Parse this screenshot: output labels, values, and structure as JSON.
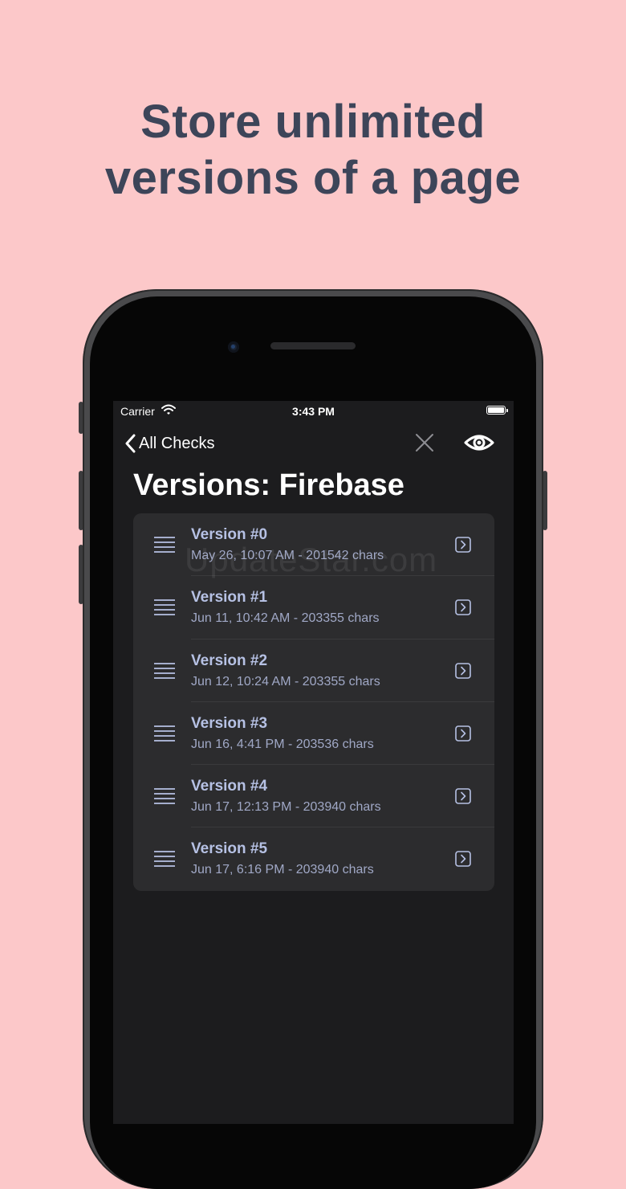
{
  "headline": {
    "line1": "Store unlimited",
    "line2": "versions of a page"
  },
  "status_bar": {
    "carrier": "Carrier",
    "time": "3:43 PM"
  },
  "nav": {
    "back_label": "All Checks",
    "close_icon": "close-icon",
    "eye_icon": "eye-icon"
  },
  "page_title": "Versions: Firebase",
  "versions": [
    {
      "title": "Version #0",
      "subtitle": "May 26, 10:07 AM - 201542 chars"
    },
    {
      "title": "Version #1",
      "subtitle": "Jun 11, 10:42 AM - 203355 chars"
    },
    {
      "title": "Version #2",
      "subtitle": "Jun 12, 10:24 AM - 203355 chars"
    },
    {
      "title": "Version #3",
      "subtitle": "Jun 16, 4:41 PM - 203536 chars"
    },
    {
      "title": "Version #4",
      "subtitle": "Jun 17, 12:13 PM - 203940 chars"
    },
    {
      "title": "Version #5",
      "subtitle": "Jun 17, 6:16 PM - 203940 chars"
    }
  ],
  "watermark": "UpdateStar.com",
  "colors": {
    "background": "#fcc8c9",
    "headline": "#3d4559",
    "screen": "#1c1c1e",
    "card": "#2c2c2e",
    "accent": "#b6c1e4"
  }
}
